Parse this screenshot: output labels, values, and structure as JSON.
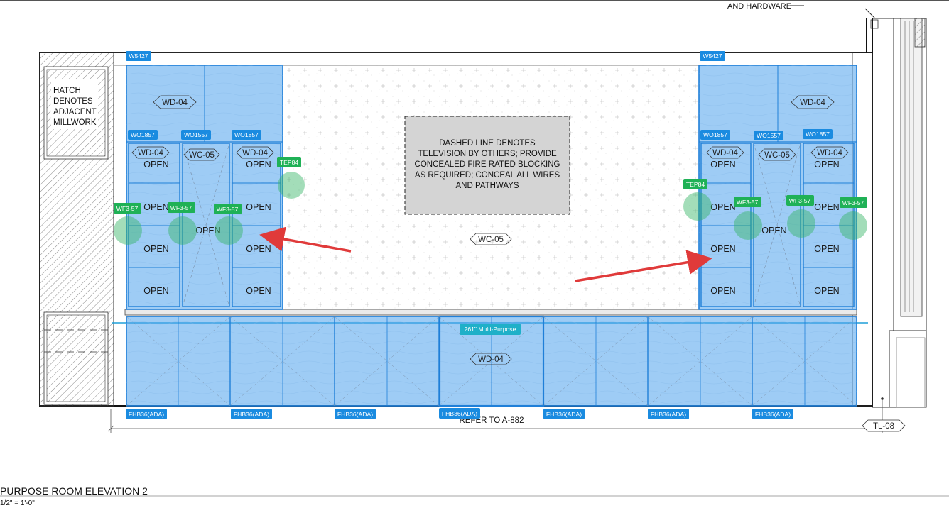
{
  "header": {
    "hardware_note": "AND HARDWARE"
  },
  "notes": {
    "hatch_lines": [
      "HATCH",
      "DENOTES",
      "ADJACENT",
      "MILLWORK"
    ],
    "tv_lines": [
      "DASHED LINE DENOTES",
      "TELEVISION BY OTHERS; PROVIDE",
      "CONCEALED FIRE RATED BLOCKING",
      "AS REQUIRED; CONCEAL ALL WIRES",
      "AND PATHWAYS"
    ],
    "refer": "REFER TO A-882"
  },
  "tags": {
    "w5427": "W5427",
    "wo1857": "WO1857",
    "wo1557": "WO1557",
    "tep84": "TEP84",
    "wf357": "WF3-57",
    "fhb": "FHB36(ADA)",
    "multipurpose": "261\" Multi-Purpose"
  },
  "labels": {
    "wd04": "WD-04",
    "wc05": "WC-05",
    "tl08": "TL-08",
    "open": "OPEN"
  },
  "title": {
    "name": "PURPOSE ROOM ELEVATION 2",
    "scale": "1/2\" = 1'-0\""
  },
  "colors": {
    "tag_blue": "#1a8be0",
    "tag_green": "#1fb156",
    "cabinet_fill": "#4ea3ec",
    "arrow": "#e03a3a"
  }
}
